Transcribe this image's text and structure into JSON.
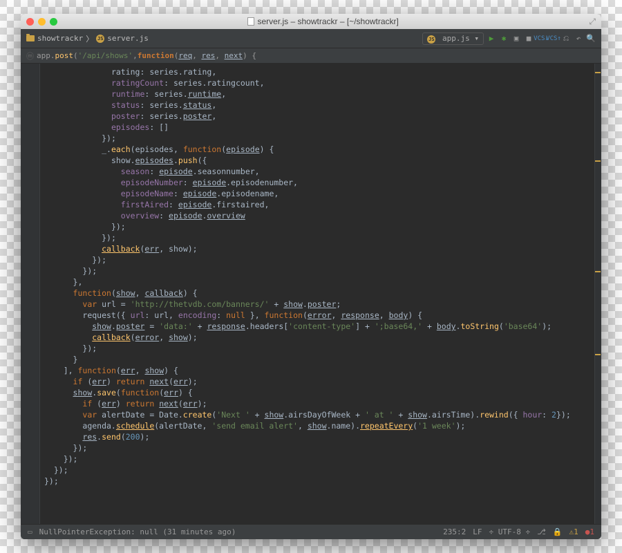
{
  "window": {
    "title": "server.js – showtrackr – [~/showtrackr]"
  },
  "breadcrumbs": {
    "folder": "showtrackr",
    "file": "server.js"
  },
  "toolbar": {
    "run_config": "app.js"
  },
  "crumb": {
    "pre": "app.",
    "method": "post",
    "open": "(",
    "str": "'/api/shows'",
    "sep": ", ",
    "kw": "function",
    "p1": "req",
    "p2": "res",
    "p3": "next",
    "tail": ") {"
  },
  "code_lines": [
    {
      "indent": 14,
      "segs": [
        {
          "t": "rating: series.rating,",
          "c": "c-id"
        }
      ]
    },
    {
      "indent": 14,
      "segs": [
        {
          "t": "ratingCount",
          "c": "c-prop"
        },
        {
          "t": ": series.ratingcount,",
          "c": "c-id"
        }
      ]
    },
    {
      "indent": 14,
      "segs": [
        {
          "t": "runtime",
          "c": "c-prop"
        },
        {
          "t": ": series.",
          "c": "c-id"
        },
        {
          "t": "runtime",
          "c": "c-id c-und"
        },
        {
          "t": ",",
          "c": "c-id"
        }
      ]
    },
    {
      "indent": 14,
      "segs": [
        {
          "t": "status",
          "c": "c-prop"
        },
        {
          "t": ": series.",
          "c": "c-id"
        },
        {
          "t": "status",
          "c": "c-id c-und"
        },
        {
          "t": ",",
          "c": "c-id"
        }
      ]
    },
    {
      "indent": 14,
      "segs": [
        {
          "t": "poster",
          "c": "c-prop"
        },
        {
          "t": ": series.",
          "c": "c-id"
        },
        {
          "t": "poster",
          "c": "c-id c-und"
        },
        {
          "t": ",",
          "c": "c-id"
        }
      ]
    },
    {
      "indent": 14,
      "segs": [
        {
          "t": "episodes",
          "c": "c-prop"
        },
        {
          "t": ": []",
          "c": "c-id"
        }
      ]
    },
    {
      "indent": 12,
      "segs": [
        {
          "t": "});",
          "c": "c-id"
        }
      ]
    },
    {
      "indent": 12,
      "segs": [
        {
          "t": "_.",
          "c": "c-id"
        },
        {
          "t": "each",
          "c": "c-fn"
        },
        {
          "t": "(episodes, ",
          "c": "c-id"
        },
        {
          "t": "function",
          "c": "c-kw"
        },
        {
          "t": "(",
          "c": "c-id"
        },
        {
          "t": "episode",
          "c": "c-id c-und"
        },
        {
          "t": ") {",
          "c": "c-id"
        }
      ]
    },
    {
      "indent": 14,
      "segs": [
        {
          "t": "show.",
          "c": "c-id"
        },
        {
          "t": "episodes",
          "c": "c-id c-und"
        },
        {
          "t": ".",
          "c": "c-id"
        },
        {
          "t": "push",
          "c": "c-fn"
        },
        {
          "t": "({",
          "c": "c-id"
        }
      ]
    },
    {
      "indent": 16,
      "segs": [
        {
          "t": "season",
          "c": "c-prop"
        },
        {
          "t": ": ",
          "c": "c-id"
        },
        {
          "t": "episode",
          "c": "c-id c-und"
        },
        {
          "t": ".seasonnumber,",
          "c": "c-id"
        }
      ]
    },
    {
      "indent": 16,
      "segs": [
        {
          "t": "episodeNumber",
          "c": "c-prop"
        },
        {
          "t": ": ",
          "c": "c-id"
        },
        {
          "t": "episode",
          "c": "c-id c-und"
        },
        {
          "t": ".episodenumber,",
          "c": "c-id"
        }
      ]
    },
    {
      "indent": 16,
      "segs": [
        {
          "t": "episodeName",
          "c": "c-prop"
        },
        {
          "t": ": ",
          "c": "c-id"
        },
        {
          "t": "episode",
          "c": "c-id c-und"
        },
        {
          "t": ".episodename,",
          "c": "c-id"
        }
      ]
    },
    {
      "indent": 16,
      "segs": [
        {
          "t": "firstAired",
          "c": "c-prop"
        },
        {
          "t": ": ",
          "c": "c-id"
        },
        {
          "t": "episode",
          "c": "c-id c-und"
        },
        {
          "t": ".firstaired,",
          "c": "c-id"
        }
      ]
    },
    {
      "indent": 16,
      "segs": [
        {
          "t": "overview",
          "c": "c-prop"
        },
        {
          "t": ": ",
          "c": "c-id"
        },
        {
          "t": "episode",
          "c": "c-id c-und"
        },
        {
          "t": ".",
          "c": "c-id"
        },
        {
          "t": "overview",
          "c": "c-id c-und"
        }
      ]
    },
    {
      "indent": 14,
      "segs": [
        {
          "t": "});",
          "c": "c-id"
        }
      ]
    },
    {
      "indent": 12,
      "segs": [
        {
          "t": "});",
          "c": "c-id"
        }
      ]
    },
    {
      "indent": 12,
      "segs": [
        {
          "t": "callback",
          "c": "c-fn c-und"
        },
        {
          "t": "(",
          "c": "c-id"
        },
        {
          "t": "err",
          "c": "c-id c-und"
        },
        {
          "t": ", show);",
          "c": "c-id"
        }
      ]
    },
    {
      "indent": 10,
      "segs": [
        {
          "t": "});",
          "c": "c-id"
        }
      ]
    },
    {
      "indent": 8,
      "segs": [
        {
          "t": "});",
          "c": "c-id"
        }
      ]
    },
    {
      "indent": 6,
      "segs": [
        {
          "t": "},",
          "c": "c-id"
        }
      ]
    },
    {
      "indent": 6,
      "segs": [
        {
          "t": "function",
          "c": "c-kw"
        },
        {
          "t": "(",
          "c": "c-id"
        },
        {
          "t": "show",
          "c": "c-id c-und"
        },
        {
          "t": ", ",
          "c": "c-id"
        },
        {
          "t": "callback",
          "c": "c-id c-und"
        },
        {
          "t": ") {",
          "c": "c-id"
        }
      ]
    },
    {
      "indent": 8,
      "segs": [
        {
          "t": "var ",
          "c": "c-kw"
        },
        {
          "t": "url = ",
          "c": "c-id"
        },
        {
          "t": "'http://thetvdb.com/banners/'",
          "c": "c-str"
        },
        {
          "t": " + ",
          "c": "c-id"
        },
        {
          "t": "show",
          "c": "c-id c-und"
        },
        {
          "t": ".",
          "c": "c-id"
        },
        {
          "t": "poster",
          "c": "c-id c-und"
        },
        {
          "t": ";",
          "c": "c-id"
        }
      ]
    },
    {
      "indent": 8,
      "segs": [
        {
          "t": "request({ ",
          "c": "c-id"
        },
        {
          "t": "url",
          "c": "c-prop"
        },
        {
          "t": ": url, ",
          "c": "c-id"
        },
        {
          "t": "encoding",
          "c": "c-prop"
        },
        {
          "t": ": ",
          "c": "c-id"
        },
        {
          "t": "null",
          "c": "c-kw"
        },
        {
          "t": " }, ",
          "c": "c-id"
        },
        {
          "t": "function",
          "c": "c-kw"
        },
        {
          "t": "(",
          "c": "c-id"
        },
        {
          "t": "error",
          "c": "c-id c-und"
        },
        {
          "t": ", ",
          "c": "c-id"
        },
        {
          "t": "response",
          "c": "c-id c-und"
        },
        {
          "t": ", ",
          "c": "c-id"
        },
        {
          "t": "body",
          "c": "c-id c-und"
        },
        {
          "t": ") {",
          "c": "c-id"
        }
      ]
    },
    {
      "indent": 10,
      "segs": [
        {
          "t": "show",
          "c": "c-id c-und"
        },
        {
          "t": ".",
          "c": "c-id"
        },
        {
          "t": "poster",
          "c": "c-id c-und"
        },
        {
          "t": " = ",
          "c": "c-id"
        },
        {
          "t": "'data:'",
          "c": "c-str"
        },
        {
          "t": " + ",
          "c": "c-id"
        },
        {
          "t": "response",
          "c": "c-id c-und"
        },
        {
          "t": ".headers[",
          "c": "c-id"
        },
        {
          "t": "'content-type'",
          "c": "c-str"
        },
        {
          "t": "] + ",
          "c": "c-id"
        },
        {
          "t": "';base64,'",
          "c": "c-str"
        },
        {
          "t": " + ",
          "c": "c-id"
        },
        {
          "t": "body",
          "c": "c-id c-und"
        },
        {
          "t": ".",
          "c": "c-id"
        },
        {
          "t": "toString",
          "c": "c-fn"
        },
        {
          "t": "(",
          "c": "c-id"
        },
        {
          "t": "'base64'",
          "c": "c-str"
        },
        {
          "t": ");",
          "c": "c-id"
        }
      ]
    },
    {
      "indent": 10,
      "segs": [
        {
          "t": "callback",
          "c": "c-fn c-und"
        },
        {
          "t": "(",
          "c": "c-id"
        },
        {
          "t": "error",
          "c": "c-id c-und"
        },
        {
          "t": ", ",
          "c": "c-id"
        },
        {
          "t": "show",
          "c": "c-id c-und"
        },
        {
          "t": ");",
          "c": "c-id"
        }
      ]
    },
    {
      "indent": 8,
      "segs": [
        {
          "t": "});",
          "c": "c-id"
        }
      ]
    },
    {
      "indent": 6,
      "segs": [
        {
          "t": "}",
          "c": "c-id"
        }
      ]
    },
    {
      "indent": 4,
      "segs": [
        {
          "t": "], ",
          "c": "c-id"
        },
        {
          "t": "function",
          "c": "c-kw"
        },
        {
          "t": "(",
          "c": "c-id"
        },
        {
          "t": "err",
          "c": "c-id c-und"
        },
        {
          "t": ", ",
          "c": "c-id"
        },
        {
          "t": "show",
          "c": "c-id c-und"
        },
        {
          "t": ") {",
          "c": "c-id"
        }
      ]
    },
    {
      "indent": 6,
      "segs": [
        {
          "t": "if ",
          "c": "c-kw"
        },
        {
          "t": "(",
          "c": "c-id"
        },
        {
          "t": "err",
          "c": "c-id c-und"
        },
        {
          "t": ") ",
          "c": "c-id"
        },
        {
          "t": "return ",
          "c": "c-kw"
        },
        {
          "t": "next",
          "c": "c-id c-und"
        },
        {
          "t": "(",
          "c": "c-id"
        },
        {
          "t": "err",
          "c": "c-id c-und"
        },
        {
          "t": ");",
          "c": "c-id"
        }
      ]
    },
    {
      "indent": 6,
      "segs": [
        {
          "t": "show",
          "c": "c-id c-und"
        },
        {
          "t": ".",
          "c": "c-id"
        },
        {
          "t": "save",
          "c": "c-fn"
        },
        {
          "t": "(",
          "c": "c-id"
        },
        {
          "t": "function",
          "c": "c-kw"
        },
        {
          "t": "(",
          "c": "c-id"
        },
        {
          "t": "err",
          "c": "c-id c-und"
        },
        {
          "t": ") {",
          "c": "c-id"
        }
      ]
    },
    {
      "indent": 8,
      "segs": [
        {
          "t": "if ",
          "c": "c-kw"
        },
        {
          "t": "(",
          "c": "c-id"
        },
        {
          "t": "err",
          "c": "c-id c-und"
        },
        {
          "t": ") ",
          "c": "c-id"
        },
        {
          "t": "return ",
          "c": "c-kw"
        },
        {
          "t": "next",
          "c": "c-id c-und"
        },
        {
          "t": "(",
          "c": "c-id"
        },
        {
          "t": "err",
          "c": "c-id c-und"
        },
        {
          "t": ");",
          "c": "c-id"
        }
      ]
    },
    {
      "indent": 0,
      "segs": [
        {
          "t": "",
          "c": "c-id"
        }
      ]
    },
    {
      "indent": 8,
      "segs": [
        {
          "t": "var ",
          "c": "c-kw"
        },
        {
          "t": "alertDate = Date.",
          "c": "c-id"
        },
        {
          "t": "create",
          "c": "c-fn"
        },
        {
          "t": "(",
          "c": "c-id"
        },
        {
          "t": "'Next '",
          "c": "c-str"
        },
        {
          "t": " + ",
          "c": "c-id"
        },
        {
          "t": "show",
          "c": "c-id c-und"
        },
        {
          "t": ".airsDayOfWeek + ",
          "c": "c-id"
        },
        {
          "t": "' at '",
          "c": "c-str"
        },
        {
          "t": " + ",
          "c": "c-id"
        },
        {
          "t": "show",
          "c": "c-id c-und"
        },
        {
          "t": ".airsTime).",
          "c": "c-id"
        },
        {
          "t": "rewind",
          "c": "c-fn"
        },
        {
          "t": "({ ",
          "c": "c-id"
        },
        {
          "t": "hour",
          "c": "c-prop"
        },
        {
          "t": ": ",
          "c": "c-id"
        },
        {
          "t": "2",
          "c": "c-num"
        },
        {
          "t": "});",
          "c": "c-id"
        }
      ]
    },
    {
      "indent": 8,
      "segs": [
        {
          "t": "agenda.",
          "c": "c-id"
        },
        {
          "t": "schedule",
          "c": "c-fn c-und"
        },
        {
          "t": "(alertDate, ",
          "c": "c-id"
        },
        {
          "t": "'send email alert'",
          "c": "c-str"
        },
        {
          "t": ", ",
          "c": "c-id"
        },
        {
          "t": "show",
          "c": "c-id c-und"
        },
        {
          "t": ".name).",
          "c": "c-id"
        },
        {
          "t": "repeatEvery",
          "c": "c-fn c-und"
        },
        {
          "t": "(",
          "c": "c-id"
        },
        {
          "t": "'1 week'",
          "c": "c-str"
        },
        {
          "t": ");",
          "c": "c-id"
        }
      ]
    },
    {
      "indent": 0,
      "segs": [
        {
          "t": "",
          "c": "c-id"
        }
      ]
    },
    {
      "indent": 8,
      "segs": [
        {
          "t": "res",
          "c": "c-id c-und"
        },
        {
          "t": ".",
          "c": "c-id"
        },
        {
          "t": "send",
          "c": "c-fn"
        },
        {
          "t": "(",
          "c": "c-id"
        },
        {
          "t": "200",
          "c": "c-num"
        },
        {
          "t": ");",
          "c": "c-id"
        }
      ]
    },
    {
      "indent": 6,
      "segs": [
        {
          "t": "});",
          "c": "c-id"
        }
      ]
    },
    {
      "indent": 4,
      "segs": [
        {
          "t": "});",
          "c": "c-id"
        }
      ]
    },
    {
      "indent": 2,
      "segs": [
        {
          "t": "});",
          "c": "c-id"
        }
      ]
    },
    {
      "indent": 0,
      "segs": [
        {
          "t": "});",
          "c": "c-id"
        }
      ]
    }
  ],
  "status": {
    "message": "NullPointerException: null (31 minutes ago)",
    "pos": "235:2",
    "sep": "LF",
    "enc": "UTF-8",
    "warnings": "1",
    "errors": "1"
  }
}
